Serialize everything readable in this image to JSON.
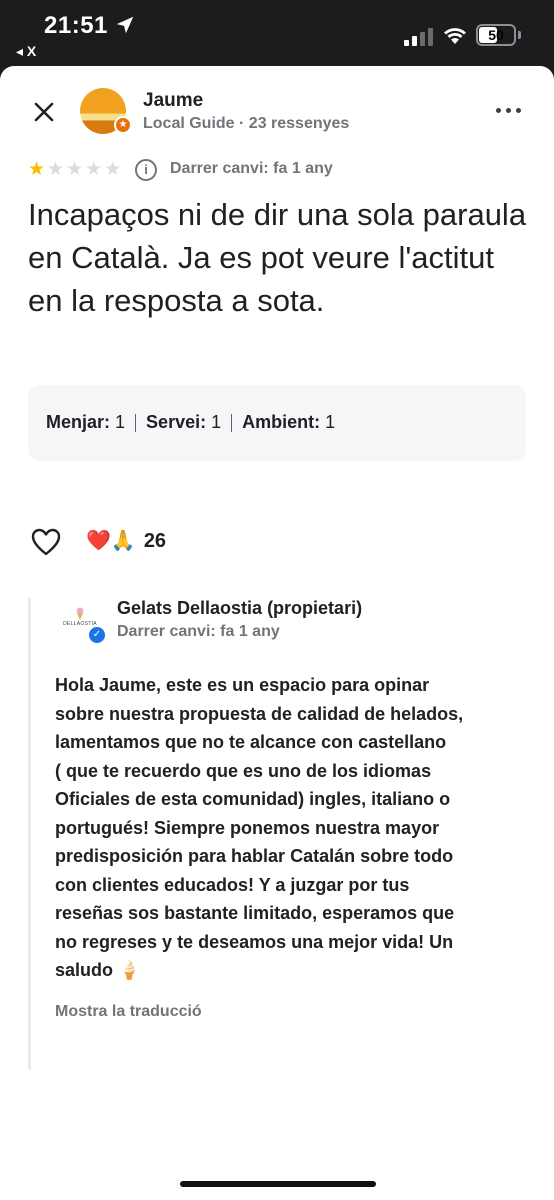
{
  "status_bar": {
    "time": "21:51",
    "back_app": "◂ X",
    "battery": "50"
  },
  "review": {
    "author_name": "Jaume",
    "author_meta": "Local Guide · 23 ressenyes",
    "rating": 1,
    "rating_max": 5,
    "edited": "Darrer canvi: fa 1 any",
    "text": "Incapaços ni de dir una sola paraula en Català. Ja es pot veure l'actitut en la resposta a sota.",
    "ratings": [
      {
        "label": "Menjar:",
        "value": "1"
      },
      {
        "label": "Servei:",
        "value": "1"
      },
      {
        "label": "Ambient:",
        "value": "1"
      }
    ],
    "reactions_emoji": "❤️🙏",
    "reactions_count": "26"
  },
  "owner_reply": {
    "logo_text": "DELLAOSTIA",
    "name": "Gelats Dellaostia (propietari)",
    "edited": "Darrer canvi: fa 1 any",
    "text": "Hola Jaume, este es un espacio para opinar\nsobre nuestra propuesta de calidad de helados,\nlamentamos que no te alcance con castellano\n( que te recuerdo que es uno de los idiomas\nOficiales de esta comunidad)  ingles, italiano o\nportugués! Siempre ponemos nuestra mayor\npredisposición para hablar Catalán sobre todo\ncon clientes educados! Y a juzgar por tus\nreseñas sos bastante limitado, esperamos que\nno regreses y te deseamos una mejor vida! Un\nsaludo 🍦",
    "translate_label": "Mostra la traducció"
  },
  "colors": {
    "star_filled": "#fbbc04",
    "star_empty": "#dadce0",
    "guide_badge": "#e8710a",
    "verified": "#1a73e8"
  }
}
